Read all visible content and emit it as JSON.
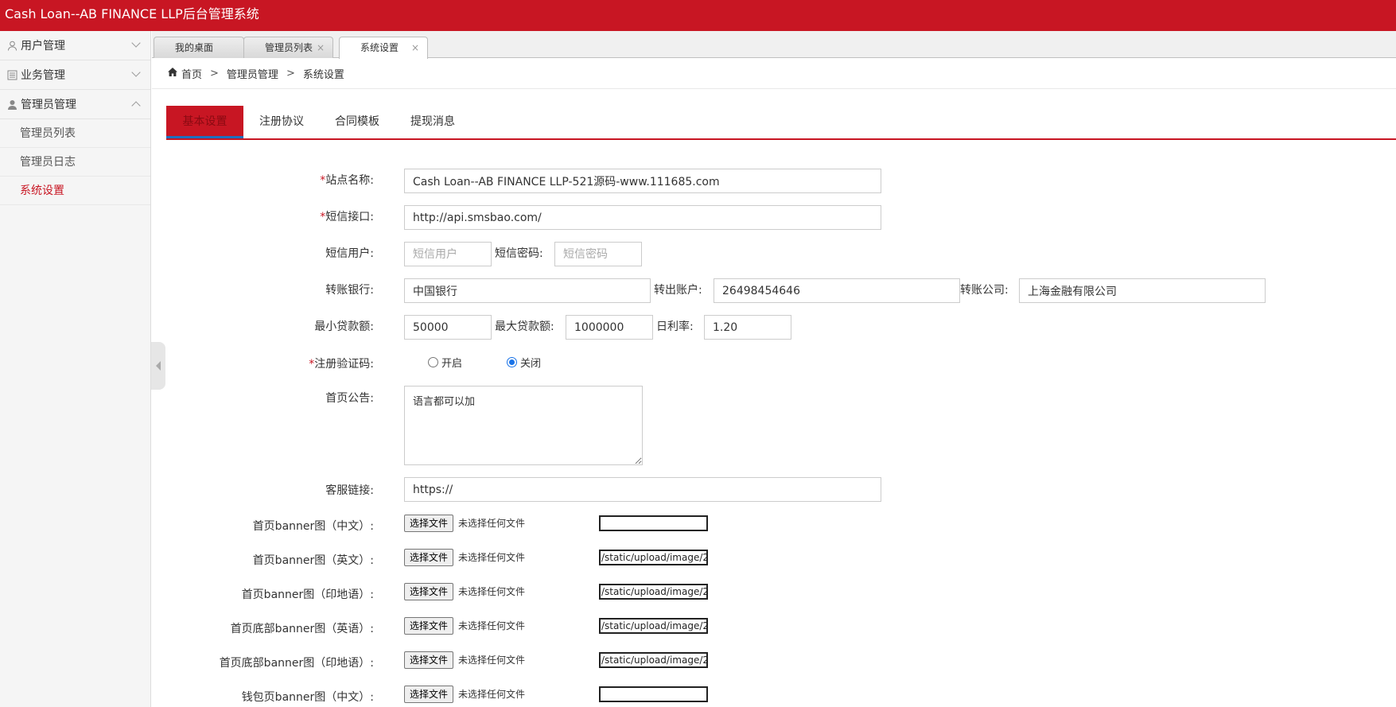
{
  "app": {
    "title": "Cash Loan--AB FINANCE LLP后台管理系统"
  },
  "sidebar": {
    "groups": [
      {
        "label": "用户管理",
        "icon": "user-outline-icon",
        "expanded": false
      },
      {
        "label": "业务管理",
        "icon": "list-icon",
        "expanded": false
      },
      {
        "label": "管理员管理",
        "icon": "admin-icon",
        "expanded": true
      }
    ],
    "items": [
      {
        "label": "管理员列表",
        "active": false
      },
      {
        "label": "管理员日志",
        "active": false
      },
      {
        "label": "系统设置",
        "active": true
      }
    ]
  },
  "page_tabs": [
    {
      "label": "我的桌面",
      "closable": false
    },
    {
      "label": "管理员列表",
      "closable": true
    },
    {
      "label": "系统设置",
      "closable": true,
      "active": true
    }
  ],
  "breadcrumb": {
    "home": "首页",
    "level1": "管理员管理",
    "level2": "系统设置",
    "sep": ">"
  },
  "content_tabs": [
    {
      "label": "基本设置",
      "active": true
    },
    {
      "label": "注册协议"
    },
    {
      "label": "合同模板"
    },
    {
      "label": "提现消息"
    }
  ],
  "form": {
    "site_name": {
      "label": "站点名称:",
      "required": true,
      "value": "Cash Loan--AB FINANCE LLP-521源码-www.111685.com"
    },
    "sms_api": {
      "label": "短信接口:",
      "required": true,
      "value": "http://api.smsbao.com/"
    },
    "sms_user": {
      "label": "短信用户:",
      "placeholder": "短信用户"
    },
    "sms_pass": {
      "label": "短信密码:",
      "placeholder": "短信密码"
    },
    "bank": {
      "label": "转账银行:",
      "value": "中国银行"
    },
    "out_account": {
      "label": "转出账户:",
      "value": "26498454646"
    },
    "company": {
      "label": "转账公司:",
      "value": "上海金融有限公司"
    },
    "min_loan": {
      "label": "最小贷款额:",
      "value": "50000"
    },
    "max_loan": {
      "label": "最大贷款额:",
      "value": "1000000"
    },
    "daily_rate": {
      "label": "日利率:",
      "value": "1.20"
    },
    "reg_captcha": {
      "label": "注册验证码:",
      "required": true,
      "on_label": "开启",
      "off_label": "关闭",
      "selected": "关闭"
    },
    "notice": {
      "label": "首页公告:",
      "value": "语言都可以加"
    },
    "service_link": {
      "label": "客服链接:",
      "value": "https://"
    },
    "file_button": "选择文件",
    "no_file": "未选择任何文件",
    "banners": [
      {
        "label": "首页banner图（中文）:",
        "path": ""
      },
      {
        "label": "首页banner图（英文）:",
        "path": "/static/upload/image/2"
      },
      {
        "label": "首页banner图（印地语）:",
        "path": "/static/upload/image/2"
      },
      {
        "label": "首页底部banner图（英语）:",
        "path": "/static/upload/image/2"
      },
      {
        "label": "首页底部banner图（印地语）:",
        "path": "/static/upload/image/2"
      },
      {
        "label": "钱包页banner图（中文）:",
        "path": ""
      }
    ]
  },
  "colors": {
    "brand": "#c81623",
    "accent": "#1a73e8"
  }
}
